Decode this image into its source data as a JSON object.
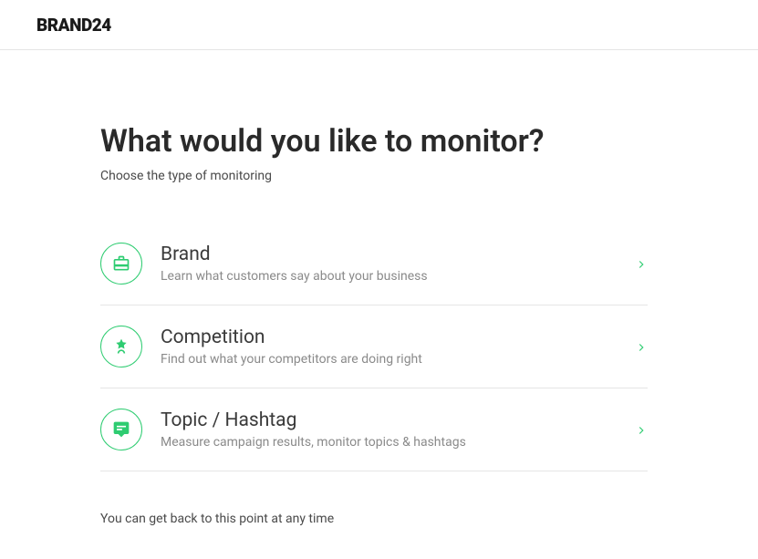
{
  "header": {
    "logo": "BRAND24"
  },
  "main": {
    "title": "What would you like to monitor?",
    "subtitle": "Choose the type of monitoring",
    "options": [
      {
        "icon": "briefcase-icon",
        "title": "Brand",
        "description": "Learn what customers say about your business"
      },
      {
        "icon": "medal-icon",
        "title": "Competition",
        "description": "Find out what your competitors are doing right"
      },
      {
        "icon": "chat-icon",
        "title": "Topic / Hashtag",
        "description": "Measure campaign results, monitor topics & hashtags"
      }
    ],
    "footer": "You can get back to this point at any time"
  }
}
